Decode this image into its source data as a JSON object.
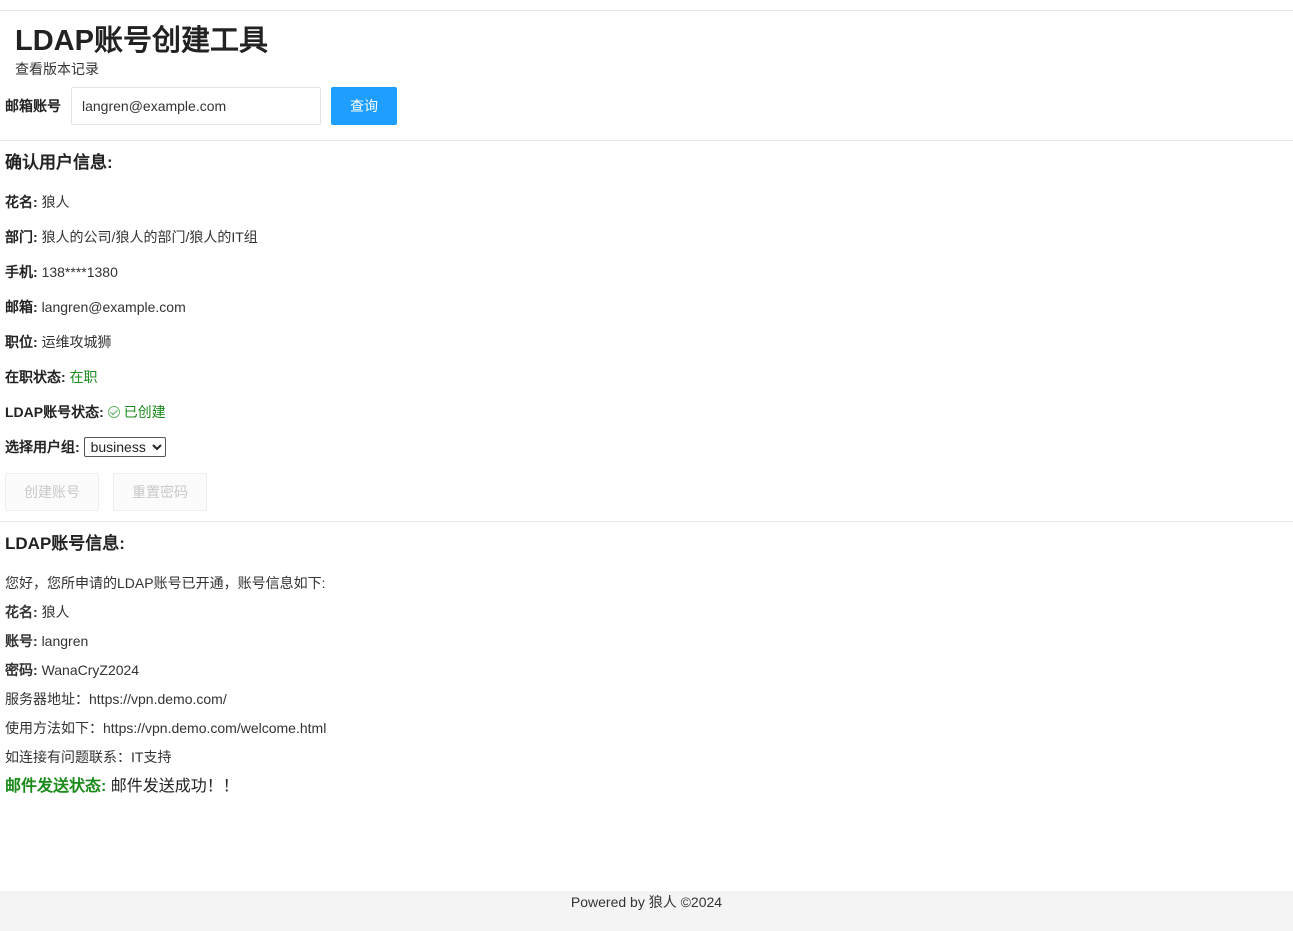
{
  "header": {
    "title": "LDAP账号创建工具",
    "version_link": "查看版本记录"
  },
  "search": {
    "label": "邮箱账号",
    "value": "langren@example.com",
    "button_label": "查询"
  },
  "user_info": {
    "title": "确认用户信息:",
    "nickname_label": "花名:",
    "nickname": "狼人",
    "department_label": "部门:",
    "department": "狼人的公司/狼人的部门/狼人的IT组",
    "phone_label": "手机:",
    "phone": "138****1380",
    "email_label": "邮箱:",
    "email": "langren@example.com",
    "position_label": "职位:",
    "position": "运维攻城狮",
    "employment_label": "在职状态:",
    "employment": "在职",
    "ldap_status_label": "LDAP账号状态:",
    "ldap_status": "已创建",
    "group_label": "选择用户组:",
    "group_selected": "business",
    "create_button": "创建账号",
    "reset_button": "重置密码"
  },
  "ldap_info": {
    "title": "LDAP账号信息:",
    "greeting": "您好，您所申请的LDAP账号已开通，账号信息如下:",
    "nickname_label": "花名:",
    "nickname": "狼人",
    "account_label": "账号:",
    "account": "langren",
    "password_label": "密码:",
    "password": "WanaCryZ2024",
    "server_line": "服务器地址：https://vpn.demo.com/",
    "usage_line": "使用方法如下：https://vpn.demo.com/welcome.html",
    "contact_line": "如连接有问题联系：IT支持",
    "mail_status_label": "邮件发送状态:",
    "mail_status": "邮件发送成功！！"
  },
  "footer": {
    "text": "Powered by 狼人 ©2024"
  },
  "colors": {
    "primary": "#1e9fff",
    "success": "#1a8a1a"
  }
}
